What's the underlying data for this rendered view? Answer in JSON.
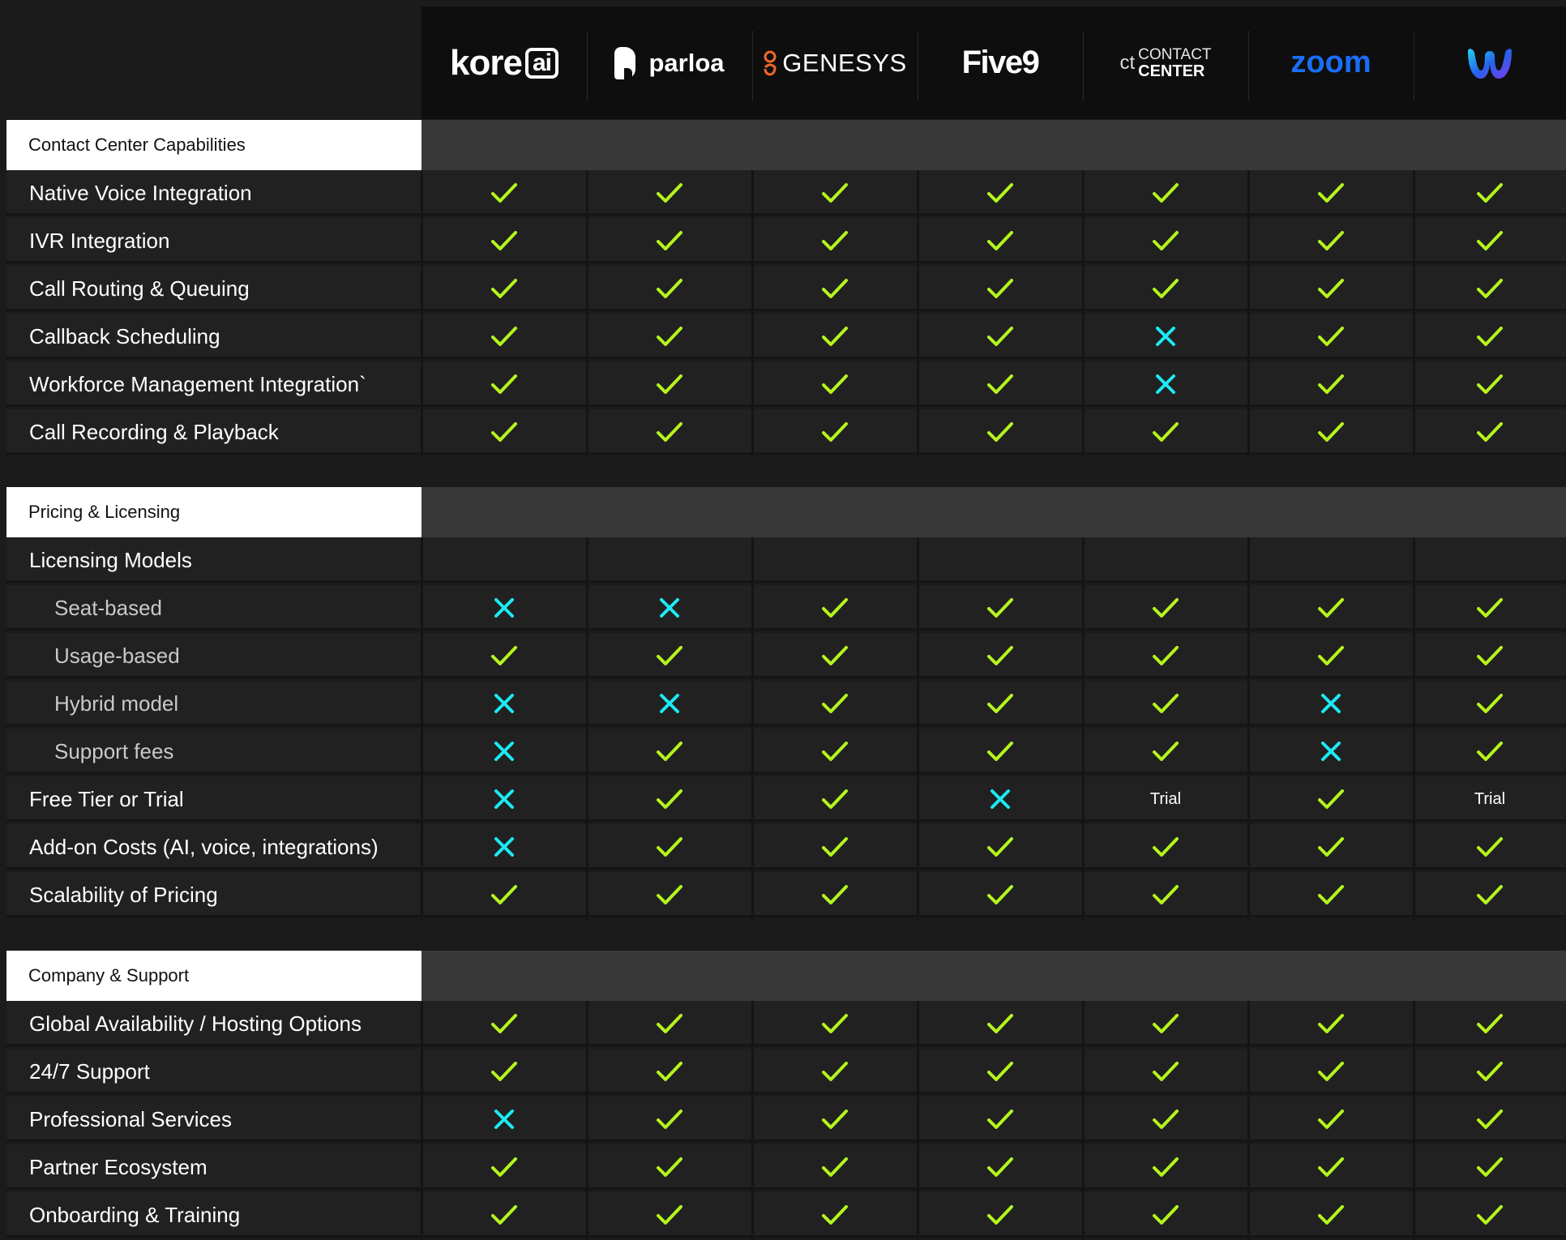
{
  "colors": {
    "check": "#b5f51d",
    "cross": "#1de9f5",
    "background": "#1b1b1b",
    "zoom_blue": "#1a6ef5"
  },
  "vendors": [
    {
      "name": "kore.ai",
      "logo_text": "kore",
      "logo_badge": "ai"
    },
    {
      "name": "parloa",
      "logo_text": "parloa"
    },
    {
      "name": "GENESYS",
      "logo_text": "GENESYS"
    },
    {
      "name": "Five9",
      "logo_text": "Five9"
    },
    {
      "name": "CT Contact Center",
      "logo_mark": "ct",
      "logo_line1": "CONTACT",
      "logo_line2": "CENTER"
    },
    {
      "name": "zoom",
      "logo_text": "zoom"
    },
    {
      "name": "Webex",
      "logo_icon": "webex-logo-icon"
    }
  ],
  "sections": [
    {
      "title": "Contact Center Capabilities",
      "rows": [
        {
          "label": "Native Voice Integration",
          "sub": false,
          "values": [
            "check",
            "check",
            "check",
            "check",
            "check",
            "check",
            "check"
          ]
        },
        {
          "label": "IVR Integration",
          "sub": false,
          "values": [
            "check",
            "check",
            "check",
            "check",
            "check",
            "check",
            "check"
          ]
        },
        {
          "label": "Call Routing & Queuing",
          "sub": false,
          "values": [
            "check",
            "check",
            "check",
            "check",
            "check",
            "check",
            "check"
          ]
        },
        {
          "label": "Callback Scheduling",
          "sub": false,
          "values": [
            "check",
            "check",
            "check",
            "check",
            "cross",
            "check",
            "check"
          ]
        },
        {
          "label": "Workforce Management Integration`",
          "sub": false,
          "values": [
            "check",
            "check",
            "check",
            "check",
            "cross",
            "check",
            "check"
          ]
        },
        {
          "label": "Call Recording & Playback",
          "sub": false,
          "values": [
            "check",
            "check",
            "check",
            "check",
            "check",
            "check",
            "check"
          ]
        }
      ]
    },
    {
      "title": "Pricing & Licensing",
      "rows": [
        {
          "label": "Licensing Models",
          "sub": false,
          "values": [
            "",
            "",
            "",
            "",
            "",
            "",
            ""
          ]
        },
        {
          "label": "Seat-based",
          "sub": true,
          "values": [
            "cross",
            "cross",
            "check",
            "check",
            "check",
            "check",
            "check"
          ]
        },
        {
          "label": "Usage-based",
          "sub": true,
          "values": [
            "check",
            "check",
            "check",
            "check",
            "check",
            "check",
            "check"
          ]
        },
        {
          "label": "Hybrid model",
          "sub": true,
          "values": [
            "cross",
            "cross",
            "check",
            "check",
            "check",
            "cross",
            "check"
          ]
        },
        {
          "label": "Support fees",
          "sub": true,
          "values": [
            "cross",
            "check",
            "check",
            "check",
            "check",
            "cross",
            "check"
          ]
        },
        {
          "label": "Free Tier or Trial",
          "sub": false,
          "values": [
            "cross",
            "check",
            "check",
            "cross",
            "Trial",
            "check",
            "Trial"
          ]
        },
        {
          "label": "Add-on Costs (AI, voice, integrations)",
          "sub": false,
          "values": [
            "cross",
            "check",
            "check",
            "check",
            "check",
            "check",
            "check"
          ]
        },
        {
          "label": "Scalability of Pricing",
          "sub": false,
          "values": [
            "check",
            "check",
            "check",
            "check",
            "check",
            "check",
            "check"
          ]
        }
      ]
    },
    {
      "title": "Company & Support",
      "rows": [
        {
          "label": "Global Availability / Hosting Options",
          "sub": false,
          "values": [
            "check",
            "check",
            "check",
            "check",
            "check",
            "check",
            "check"
          ]
        },
        {
          "label": "24/7 Support",
          "sub": false,
          "values": [
            "check",
            "check",
            "check",
            "check",
            "check",
            "check",
            "check"
          ]
        },
        {
          "label": "Professional Services",
          "sub": false,
          "values": [
            "cross",
            "check",
            "check",
            "check",
            "check",
            "check",
            "check"
          ]
        },
        {
          "label": "Partner Ecosystem",
          "sub": false,
          "values": [
            "check",
            "check",
            "check",
            "check",
            "check",
            "check",
            "check"
          ]
        },
        {
          "label": "Onboarding & Training",
          "sub": false,
          "values": [
            "check",
            "check",
            "check",
            "check",
            "check",
            "check",
            "check"
          ]
        }
      ]
    }
  ]
}
